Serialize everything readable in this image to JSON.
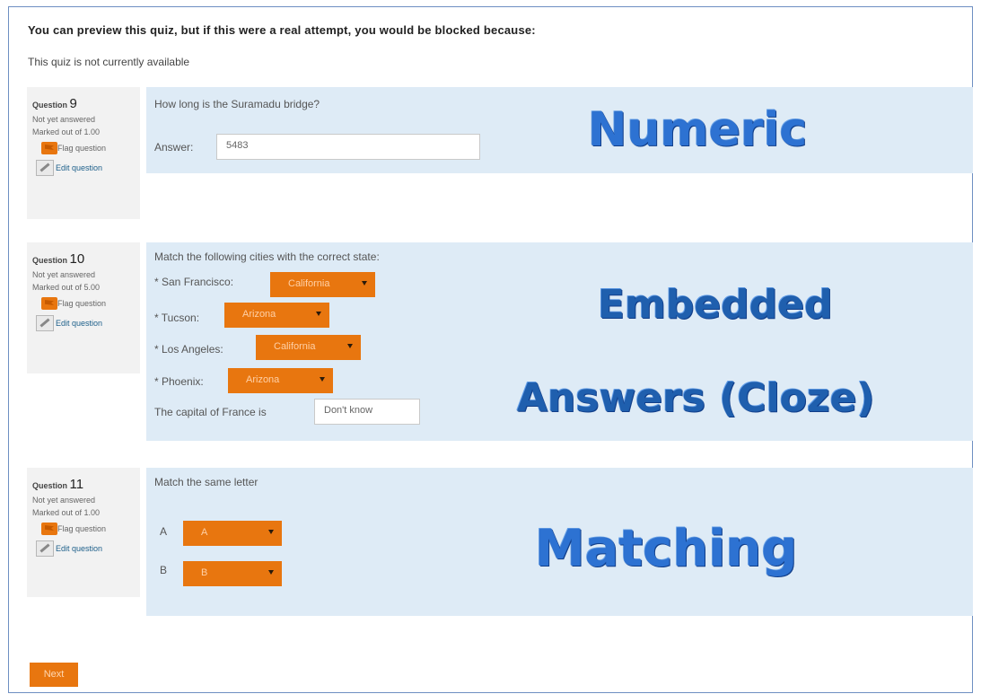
{
  "warning": {
    "title": "You can preview this quiz, but if this were a real attempt, you would be blocked because:",
    "message": "This quiz is not currently available"
  },
  "questions": [
    {
      "label": "Question",
      "number": "9",
      "status": "Not yet answered",
      "marks": "Marked out of 1.00",
      "flag_label": "Flag question",
      "edit_label": "Edit question",
      "prompt": "How long is the Suramadu bridge?",
      "answer_label": "Answer:",
      "answer_value": "5483",
      "overlay": "Numeric"
    },
    {
      "label": "Question",
      "number": "10",
      "status": "Not yet answered",
      "marks": "Marked out of 5.00",
      "flag_label": "Flag question",
      "edit_label": "Edit question",
      "prompt": "Match the following cities with the correct state:",
      "items": [
        {
          "label": "* San Francisco:",
          "value": "California"
        },
        {
          "label": "* Tucson:",
          "value": "Arizona"
        },
        {
          "label": "* Los Angeles:",
          "value": "California"
        },
        {
          "label": "* Phoenix:",
          "value": "Arizona"
        }
      ],
      "capital_label": "The capital of France is",
      "capital_value": "Don't know",
      "overlay_line1": "Embedded",
      "overlay_line2": "Answers (Cloze)"
    },
    {
      "label": "Question",
      "number": "11",
      "status": "Not yet answered",
      "marks": "Marked out of 1.00",
      "flag_label": "Flag question",
      "edit_label": "Edit question",
      "prompt": "Match the same letter",
      "items": [
        {
          "label": "A",
          "value": "A"
        },
        {
          "label": "B",
          "value": "B"
        }
      ],
      "overlay": "Matching"
    }
  ],
  "next_button": "Next",
  "colors": {
    "accent": "#e8760f",
    "panel_bg": "#deebf6",
    "info_bg": "#f2f2f2",
    "overlay_text": "#2d72d2"
  }
}
